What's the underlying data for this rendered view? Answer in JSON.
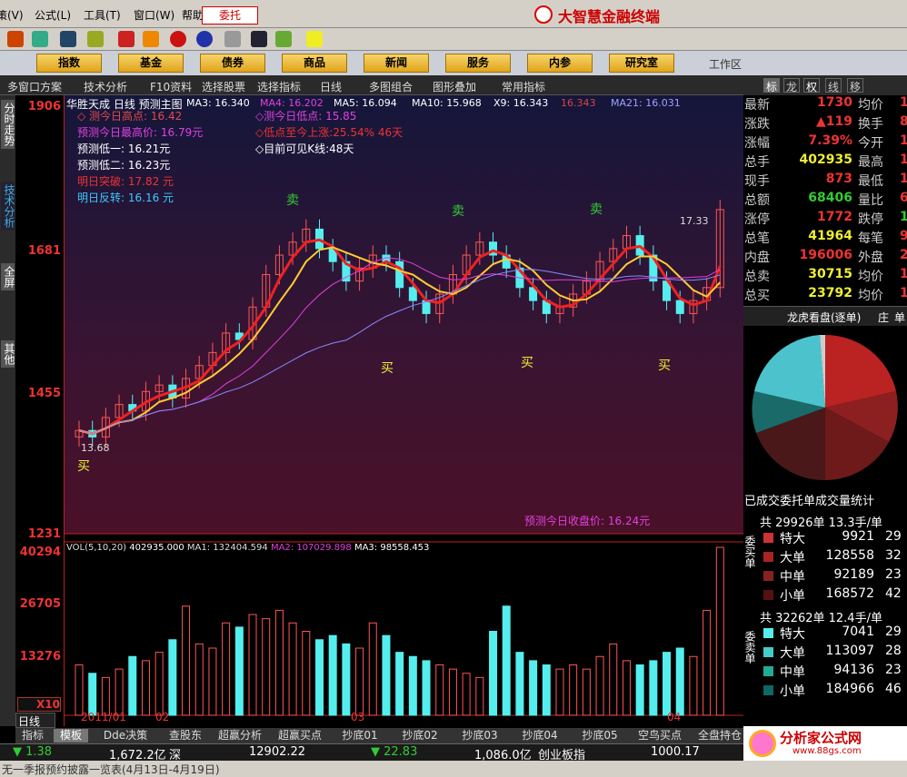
{
  "menu": {
    "items": [
      "策(V)",
      "公式(L)",
      "工具(T)",
      "窗口(W)",
      "帮助(H)"
    ],
    "entrust": "委托",
    "brand": "大智慧金融终端"
  },
  "nav": {
    "buttons": [
      "指数",
      "基金",
      "债券",
      "商品",
      "新闻",
      "服务",
      "内参",
      "研究室"
    ],
    "workzone": "工作区"
  },
  "tabs": [
    "多窗口方案",
    "技术分析",
    "F10资料",
    "选择股票",
    "选择指标",
    "日线",
    "多图组合",
    "图形叠加",
    "常用指标"
  ],
  "right_tabs": [
    "标",
    "龙",
    "权",
    "线",
    "移"
  ],
  "side_tabs": [
    "分时走势",
    "技术分析",
    "全屏",
    "其他"
  ],
  "chart": {
    "title": "华胜天成 日线 预测主图",
    "ma_line": [
      "MA3: 16.340",
      "MA4: 16.202",
      "MA5: 16.094",
      "MA10: 15.968",
      "X9: 16.343",
      "16.343",
      "MA21: 16.031"
    ],
    "pred": [
      {
        "text": "◇ 测今日高点: 16.42",
        "color": "#e14b4b"
      },
      {
        "text": "预测今日最高价: 16.79元",
        "color": "#e040e0"
      },
      {
        "text": "预测低一: 16.21元",
        "color": "#ffffff"
      },
      {
        "text": "预测低二: 16.23元",
        "color": "#ffffff"
      },
      {
        "text": "明日突破: 17.82 元",
        "color": "#e33"
      },
      {
        "text": "明日反转: 16.16 元",
        "color": "#3fc8ff"
      }
    ],
    "pred2": [
      {
        "text": "◇测今日低点: 15.85",
        "color": "#e040e0"
      },
      {
        "text": "◇低点至今上涨:25.54%  46天",
        "color": "#e33"
      },
      {
        "text": "◇目前可见K线:48天",
        "color": "#ffffff"
      }
    ],
    "price_labels": [
      "1906",
      "1681",
      "1455",
      "1231"
    ],
    "low_mark": "13.68",
    "high_mark": "17.33",
    "sell": "卖",
    "buy": "买",
    "close_pred": "预测今日收盘价: 16.24元"
  },
  "volume": {
    "header": [
      "VOL(5,10,20)",
      "402935.000",
      "MA1: 132404.594",
      "MA2: 107029.898",
      "MA3: 98558.453"
    ],
    "labels": [
      "40294",
      "26705",
      "13276",
      "X10"
    ],
    "months": [
      "2011/01",
      "02",
      "03",
      "04"
    ]
  },
  "quote": {
    "rows": [
      [
        "最新",
        "1730",
        "均价",
        "169"
      ],
      [
        "涨跌",
        "▲119",
        "换手",
        "8.36"
      ],
      [
        "涨幅",
        "7.39%",
        "今开",
        "165"
      ],
      [
        "总手",
        "402935",
        "最高",
        "173"
      ],
      [
        "现手",
        "873",
        "最低",
        "165"
      ],
      [
        "总额",
        "68406",
        "量比",
        "6.6"
      ],
      [
        "涨停",
        "1772",
        "跌停",
        "145"
      ],
      [
        "总笔",
        "41964",
        "每笔",
        "9"
      ],
      [
        "内盘",
        "196006",
        "外盘",
        "20692"
      ],
      [
        "总卖",
        "30715",
        "均价",
        "176"
      ],
      [
        "总买",
        "23792",
        "均价",
        "166"
      ]
    ],
    "pie_title": "龙虎看盘(逐单)",
    "pie_tab2": "庄",
    "pie_tab3": "单",
    "stats_title": "已成交委托单成交量统计",
    "buy_total": "共 29926单 13.3手/单",
    "buy_label": "委买单",
    "buy": [
      [
        "特大",
        "9921",
        "29"
      ],
      [
        "大单",
        "128558",
        "32"
      ],
      [
        "中单",
        "92189",
        "23"
      ],
      [
        "小单",
        "168572",
        "42"
      ]
    ],
    "sell_total": "共 32262单 12.4手/单",
    "sell_label": "委卖单",
    "sell": [
      [
        "特大",
        "7041",
        "29"
      ],
      [
        "大单",
        "113097",
        "28"
      ],
      [
        "中单",
        "94136",
        "23"
      ],
      [
        "小单",
        "184966",
        "46"
      ]
    ]
  },
  "bottom_tabs": [
    "指标",
    "模板",
    "Dde决策",
    "查股东",
    "超赢分析",
    "超赢买点",
    "抄底01",
    "抄底02",
    "抄底03",
    "抄底04",
    "抄底05",
    "空鸟买点",
    "全盘持仓",
    "其他"
  ],
  "daytag": "日线",
  "status": {
    "a_change": "▼ 1.38",
    "a_amount": "1,672.2亿",
    "a_name": "深",
    "b_index": "12902.22",
    "b_change": "▼ 22.83",
    "b_amount": "1,086.0亿",
    "b_name": "创业板指",
    "c_index": "1000.17"
  },
  "ticker": "无一季报预约披露一览表(4月13日-4月19日)",
  "watermark": {
    "title": "分析家公式网",
    "url": "www.88gs.com"
  }
}
